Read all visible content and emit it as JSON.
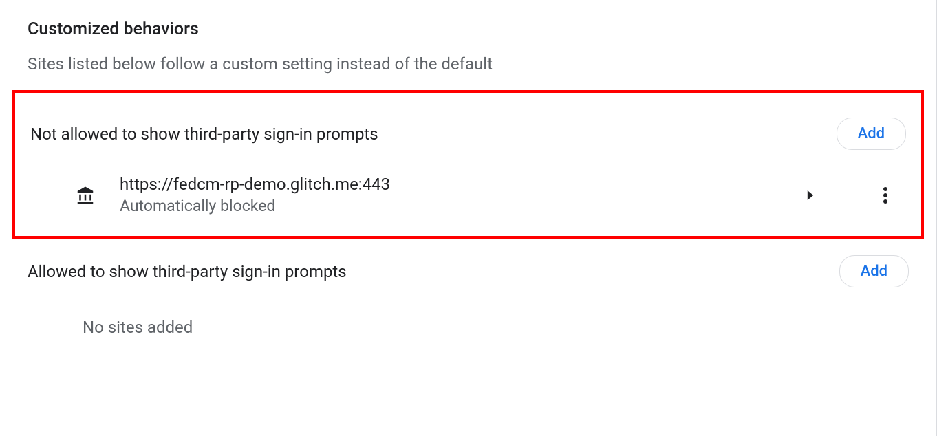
{
  "section": {
    "title": "Customized behaviors",
    "description": "Sites listed below follow a custom setting instead of the default"
  },
  "blocked": {
    "heading": "Not allowed to show third-party sign-in prompts",
    "add_label": "Add",
    "sites": [
      {
        "url": "https://fedcm-rp-demo.glitch.me:443",
        "status": "Automatically blocked"
      }
    ]
  },
  "allowed": {
    "heading": "Allowed to show third-party sign-in prompts",
    "add_label": "Add",
    "empty_text": "No sites added"
  }
}
